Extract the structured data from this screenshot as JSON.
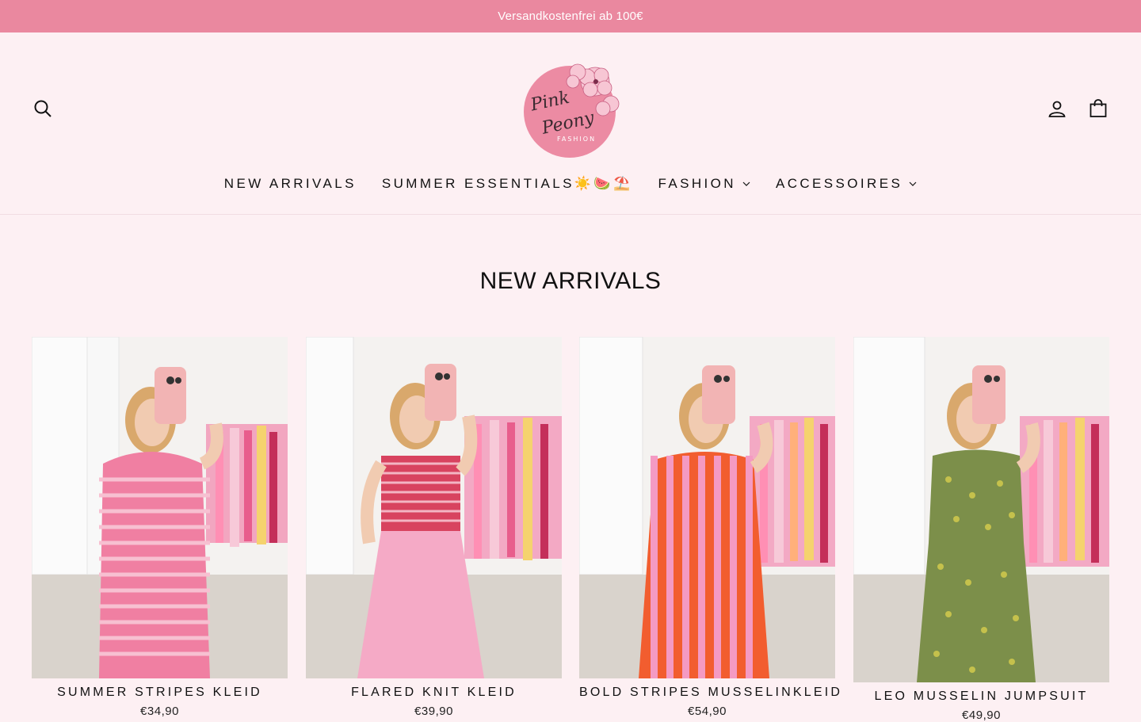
{
  "announcement": "Versandkostenfrei ab 100€",
  "header": {
    "search_icon": "search-icon",
    "account_icon": "user-icon",
    "cart_icon": "shopping-bag-icon",
    "logo_text": {
      "line1": "Pink",
      "line2": "Peony",
      "line3": "FASHION"
    }
  },
  "nav": {
    "items": [
      {
        "label": "NEW ARRIVALS",
        "has_dropdown": false
      },
      {
        "label": "SUMMER ESSENTIALS☀️🍉⛱️",
        "has_dropdown": false
      },
      {
        "label": "FASHION",
        "has_dropdown": true
      },
      {
        "label": "ACCESSOIRES",
        "has_dropdown": true
      }
    ]
  },
  "section": {
    "title": "NEW ARRIVALS"
  },
  "colors": {
    "background": "#fdf0f3",
    "announcement_bar": "#ea889f",
    "logo_pink": "#ec8ba3"
  },
  "products": [
    {
      "title": "SUMMER STRIPES KLEID",
      "price": "€34,90",
      "garment": "pink-striped-dress"
    },
    {
      "title": "FLARED KNIT KLEID",
      "price": "€39,90",
      "garment": "red-knit-top-pink-skirt"
    },
    {
      "title": "BOLD STRIPES MUSSELINKLEID",
      "price": "€54,90",
      "garment": "orange-pink-striped-dress"
    },
    {
      "title": "LEO MUSSELIN JUMPSUIT",
      "price": "€49,90",
      "garment": "green-leopard-jumpsuit"
    }
  ]
}
